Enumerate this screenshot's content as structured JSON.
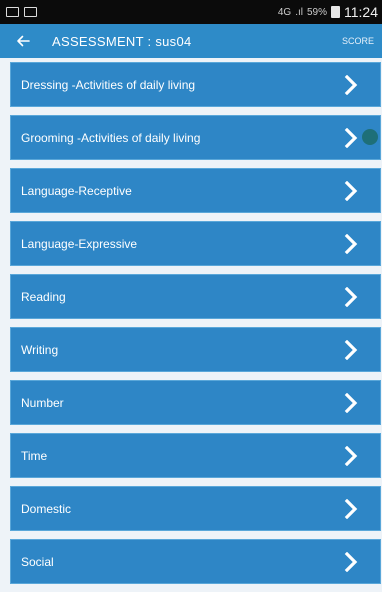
{
  "status_bar": {
    "network": "4G",
    "signal": ".ıl",
    "battery": "59%",
    "time": "11:24"
  },
  "header": {
    "title": "ASSESSMENT : sus04",
    "score_label": "SCORE",
    "back_icon": "arrow-left-icon"
  },
  "categories": [
    {
      "label": "Dressing -Activities of daily living"
    },
    {
      "label": "Grooming -Activities of daily living"
    },
    {
      "label": "Language-Receptive"
    },
    {
      "label": "Language-Expressive"
    },
    {
      "label": "Reading"
    },
    {
      "label": "Writing"
    },
    {
      "label": "Number"
    },
    {
      "label": "Time"
    },
    {
      "label": "Domestic"
    },
    {
      "label": "Social"
    }
  ],
  "colors": {
    "app_bar": "#2e8bc8",
    "row": "#2e86c6",
    "background": "#eef3f8",
    "status_bar": "#0b0b0b"
  }
}
